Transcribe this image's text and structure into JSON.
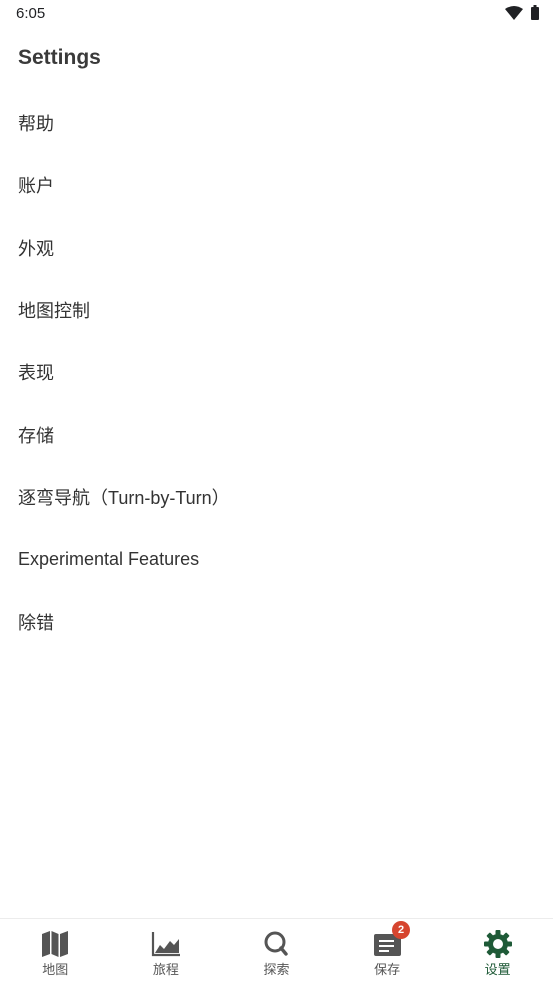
{
  "status_bar": {
    "time": "6:05"
  },
  "page": {
    "title": "Settings"
  },
  "settings": {
    "items": [
      {
        "label": "帮助"
      },
      {
        "label": "账户"
      },
      {
        "label": "外观"
      },
      {
        "label": "地图控制"
      },
      {
        "label": "表现"
      },
      {
        "label": "存储"
      },
      {
        "label": "逐弯导航（Turn-by-Turn）"
      },
      {
        "label": "Experimental Features"
      },
      {
        "label": "除错"
      }
    ]
  },
  "bottom_nav": {
    "items": [
      {
        "label": "地图",
        "icon": "map-icon"
      },
      {
        "label": "旅程",
        "icon": "chart-icon"
      },
      {
        "label": "探索",
        "icon": "search-icon"
      },
      {
        "label": "保存",
        "icon": "list-icon",
        "badge": "2"
      },
      {
        "label": "设置",
        "icon": "gear-icon",
        "active": true
      }
    ]
  },
  "colors": {
    "active": "#1e5a37",
    "badge": "#d6452f",
    "icon": "#555555"
  }
}
